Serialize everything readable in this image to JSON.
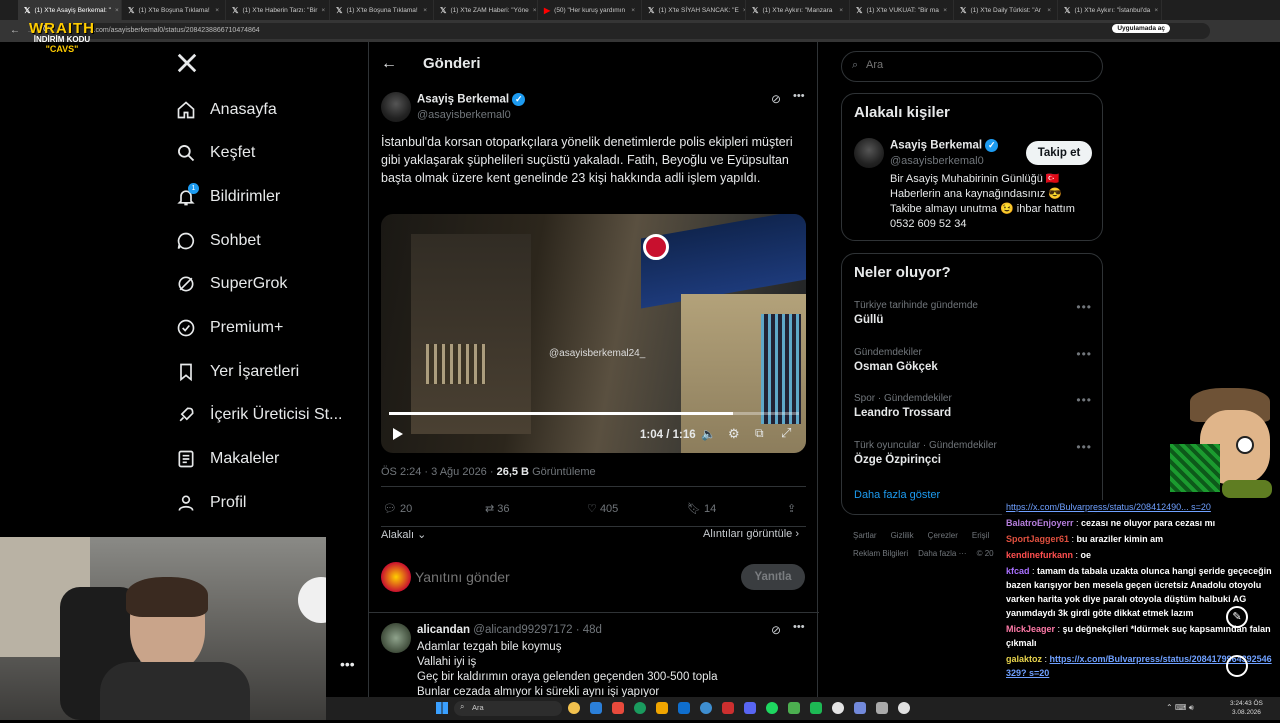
{
  "browser": {
    "tabs": [
      {
        "title": "(1) X'te Asayiş Berkemal: \"",
        "active": true
      },
      {
        "title": "(1) X'te Boşuna Tıklama!",
        "active": false
      },
      {
        "title": "(1) X'te Haberin Tarzı: \"Bir",
        "active": false
      },
      {
        "title": "(1) X'te Boşuna Tıklama!",
        "active": false
      },
      {
        "title": "(1) X'te ZAM Haberi: \"Yöne",
        "active": false
      },
      {
        "title": "(50) \"Her kuruş yardımın",
        "active": false
      },
      {
        "title": "(1) X'te SİYAH SANCAK: \"E",
        "active": false
      },
      {
        "title": "(1) X'te Aykırı: \"Manzara",
        "active": false
      },
      {
        "title": "(1) X'te VUKUAT: \"Bir ma",
        "active": false
      },
      {
        "title": "(1) X'te Daily Türkist: \"Ar",
        "active": false
      },
      {
        "title": "(1) X'te Aykırı: \"İstanbul'da",
        "active": false
      }
    ],
    "url": "x.com/asayisberkemal0/status/2084238866710474864",
    "app_chip": "Uygulamada aç"
  },
  "overlay_logo": {
    "line1": "WRAITH",
    "line2": "İNDİRİM KODU",
    "line3": "\"CAVS\""
  },
  "nav": {
    "items": [
      {
        "label": "Anasayfa",
        "icon": "home-icon"
      },
      {
        "label": "Keşfet",
        "icon": "search-icon"
      },
      {
        "label": "Bildirimler",
        "icon": "bell-icon",
        "badge": "1"
      },
      {
        "label": "Sohbet",
        "icon": "chat-icon"
      },
      {
        "label": "SuperGrok",
        "icon": "grok-icon"
      },
      {
        "label": "Premium+",
        "icon": "verified-icon"
      },
      {
        "label": "Yer İşaretleri",
        "icon": "bookmark-icon"
      },
      {
        "label": "İçerik Üreticisi St...",
        "icon": "rocket-icon"
      },
      {
        "label": "Makaleler",
        "icon": "article-icon"
      },
      {
        "label": "Profil",
        "icon": "person-icon"
      }
    ]
  },
  "post": {
    "header": "Gönderi",
    "author": "Asayiş Berkemal",
    "handle": "@asayisberkemal0",
    "text": "İstanbul'da korsan otoparkçılara yönelik denetimlerde polis ekipleri müşteri gibi yaklaşarak şüphelileri suçüstü yakaladı. Fatih, Beyoğlu ve Eyüpsultan başta olmak üzere kent genelinde 23 kişi hakkında adli işlem yapıldı.",
    "video_watermark": "@asayisberkemal24_",
    "video_time": "1:04 / 1:16",
    "video_progress": 0.84,
    "timestamp": "ÖS 2:24 · 3 Ağu 2026 ·",
    "views_count": "26,5 B",
    "views_label": "Görüntüleme",
    "replies": "20",
    "reposts": "36",
    "likes": "405",
    "bookmarks": "14",
    "relevance": "Alakalı",
    "quotes_link": "Alıntıları görüntüle",
    "reply_placeholder": "Yanıtını gönder",
    "reply_button": "Yanıtla"
  },
  "reply": {
    "author": "alicandan",
    "handle": "@alicand99297172 · 48d",
    "lines": [
      "Adamlar tezgah bile koymuş",
      "Vallahi iyi iş",
      "Geç bir kaldırımın oraya gelenden geçenden 300-500 topla",
      "Bunlar cezada almıyor ki sürekli aynı işi yapıyor"
    ]
  },
  "sidebar": {
    "search_placeholder": "Ara",
    "related_title": "Alakalı kişiler",
    "related_name": "Asayiş Berkemal",
    "related_handle": "@asayisberkemal0",
    "follow_button": "Takip et",
    "bio_lines": [
      "Bir Asayiş Muhabirinin Günlüğü 🇹🇷",
      "Haberlerin ana kaynağındasınız 😎",
      "Takibe almayı unutma 😉 ihbar hattım",
      "0532 609 52 34"
    ],
    "trends_title": "Neler oluyor?",
    "trends": [
      {
        "category": "Türkiye tarihinde gündemde",
        "name": "Güllü"
      },
      {
        "category": "Gündemdekiler",
        "name": "Osman Gökçek"
      },
      {
        "category": "Spor · Gündemdekiler",
        "name": "Leandro Trossard"
      },
      {
        "category": "Türk oyuncular · Gündemdekiler",
        "name": "Özge Özpirinçci"
      }
    ],
    "show_more": "Daha fazla göster",
    "footer_row1": [
      "Şartlar",
      "Gizlilik",
      "Çerezler",
      "Erişil"
    ],
    "footer_row2": [
      "Reklam Bilgileri",
      "Daha fazla ···",
      "© 20"
    ]
  },
  "chat": {
    "top_fragment": "https://x.com/Bulvarpress/status/208412490... s=20",
    "messages": [
      {
        "user": "BalatroEnjoyerr",
        "text": "cezası ne oluyor para cezası mı",
        "color": "#b57edc"
      },
      {
        "user": "SportJagger61",
        "text": "bu araziler kimin am",
        "color": "#e0503f"
      },
      {
        "user": "kendinefurkann",
        "text": "oe",
        "color": "#ff4f4f"
      },
      {
        "user": "kfcad",
        "text": "tamam da tabala uzakta olunca hangi şeride geçeceğin bazen karışıyor ben mesela geçen ücretsiz Anadolu otoyolu varken harita yok diye paralı otoyola düştüm halbuki AG yanımdaydı 3k girdi göte dikkat etmek lazım",
        "color": "#a970ff"
      },
      {
        "user": "MickJeager",
        "text": "şu değnekçileri *ldürmek suç kapsamından falan çıkmalı",
        "color": "#ff7aa8"
      },
      {
        "user": "galaktoz",
        "text": "https://x.com/Bulvarpress/status/2084179964392546329? s=20",
        "color": "#e8d44d"
      }
    ]
  },
  "taskbar": {
    "search": "Ara",
    "time": "3:24:43 ÖS",
    "date": "3.08.2026"
  }
}
